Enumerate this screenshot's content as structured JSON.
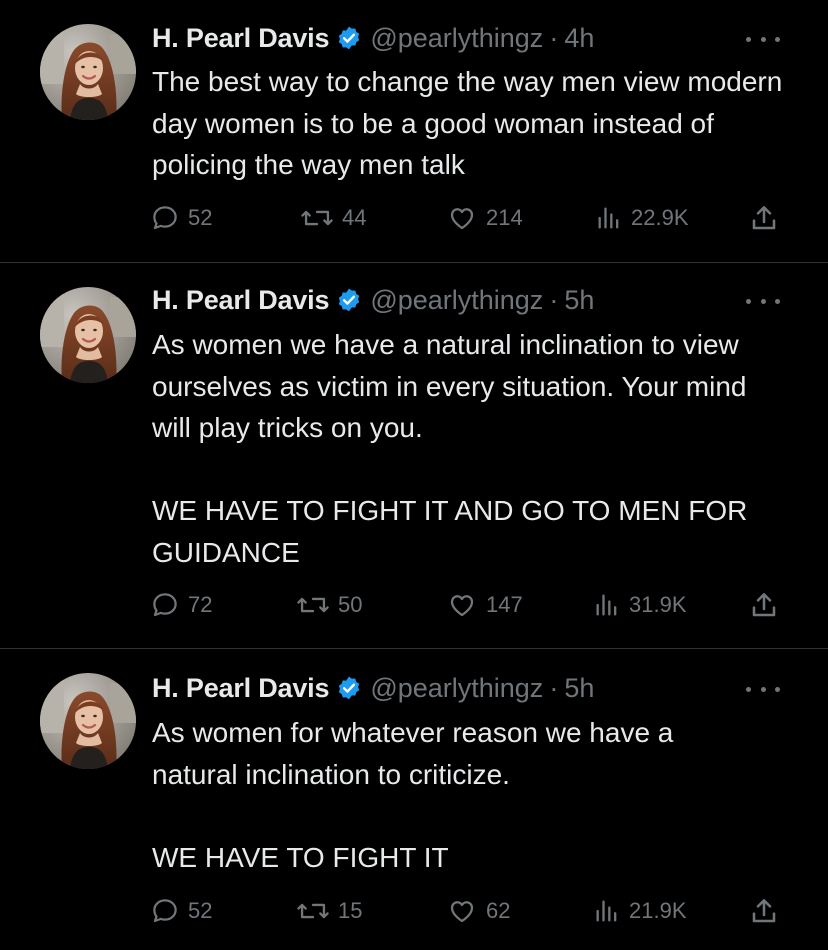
{
  "tweets": [
    {
      "name": "H. Pearl Davis",
      "handle": "@pearlythingz",
      "separator": "·",
      "time": "4h",
      "paragraphs": [
        "The best way to change the way men view modern day women is to be a good woman instead of policing the way men talk"
      ],
      "replies": "52",
      "reposts": "44",
      "likes": "214",
      "views": "22.9K"
    },
    {
      "name": "H. Pearl Davis",
      "handle": "@pearlythingz",
      "separator": "·",
      "time": "5h",
      "paragraphs": [
        "As women we have a natural inclination to view ourselves as victim in every situation. Your mind will play tricks on you.",
        "WE HAVE TO FIGHT IT AND GO TO MEN FOR GUIDANCE"
      ],
      "replies": "72",
      "reposts": "50",
      "likes": "147",
      "views": "31.9K"
    },
    {
      "name": "H. Pearl Davis",
      "handle": "@pearlythingz",
      "separator": "·",
      "time": "5h",
      "paragraphs": [
        "As women for whatever reason we have a natural inclination to criticize.",
        "WE HAVE TO FIGHT IT"
      ],
      "replies": "52",
      "reposts": "15",
      "likes": "62",
      "views": "21.9K"
    }
  ],
  "icons": {
    "verified": "verified-badge-icon",
    "more": "more-options-icon",
    "reply": "reply-icon",
    "repost": "repost-icon",
    "like": "like-icon",
    "views": "views-icon",
    "share": "share-icon"
  },
  "colors": {
    "background": "#000000",
    "text": "#e7e9ea",
    "muted": "#71767b",
    "verified": "#1d9bf0",
    "divider": "#2f3336"
  }
}
